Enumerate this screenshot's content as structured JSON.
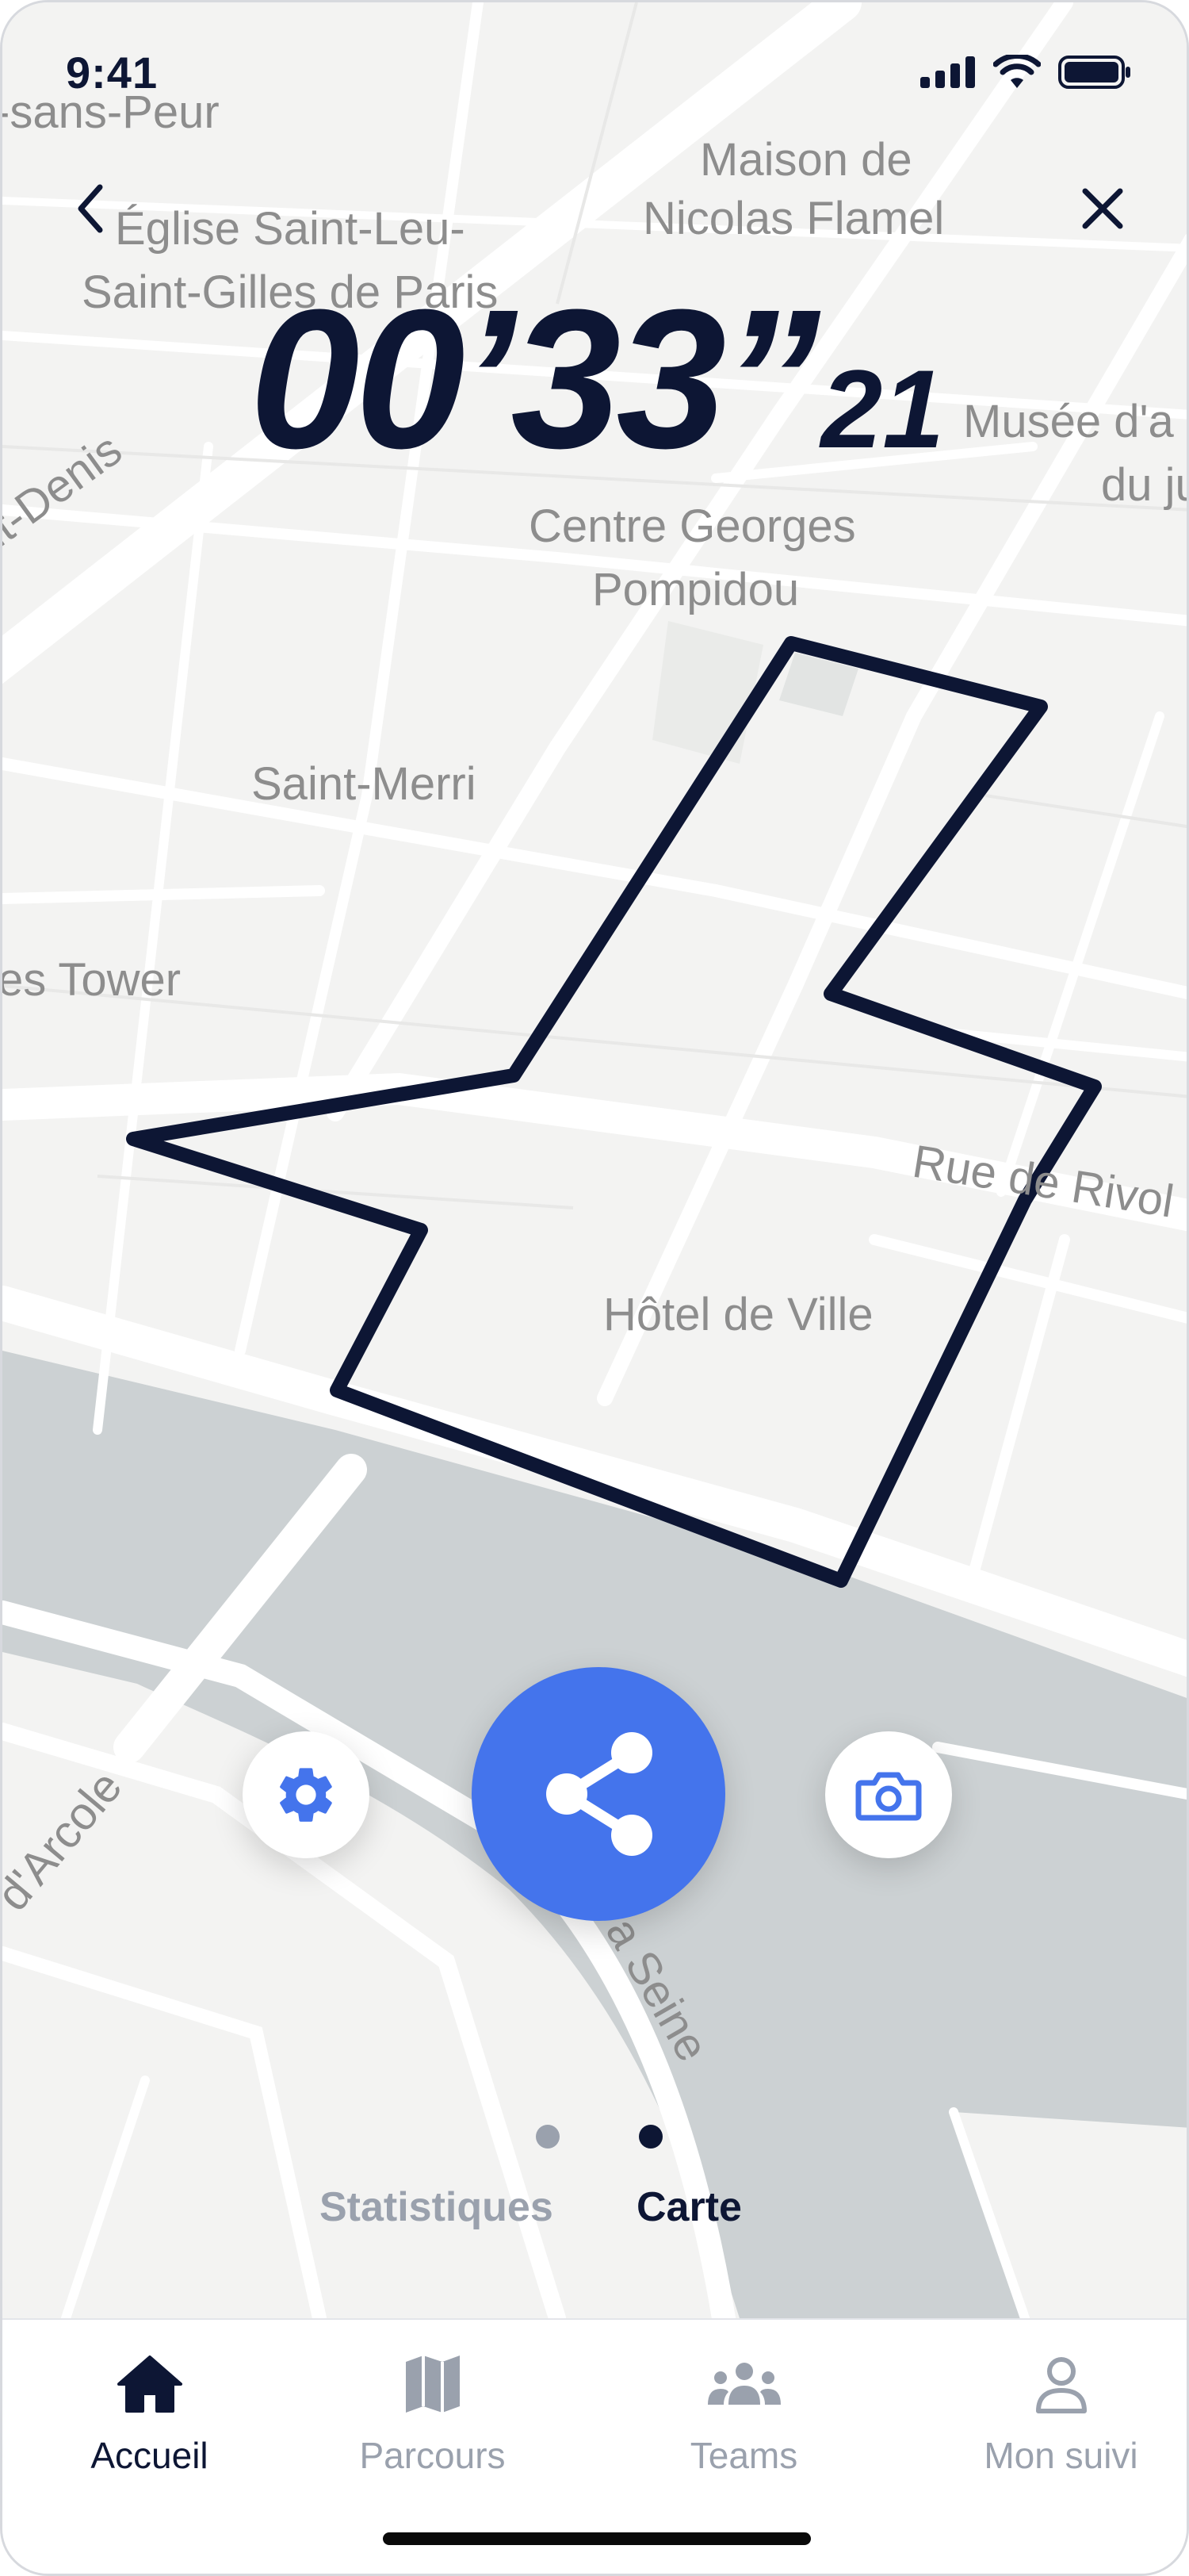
{
  "status_bar": {
    "time": "9:41"
  },
  "map": {
    "labels": {
      "sans_peur": "-sans-Peur",
      "maison_1": "Maison de",
      "maison_2": "Nicolas Flamel",
      "eglise_1": "Église Saint-Leu-",
      "eglise_2": "Saint-Gilles de Paris",
      "denis": "nt-Denis",
      "musee_1": "Musée d'a",
      "musee_2": "du ju",
      "centre_1": "Centre Georges",
      "centre_2": "Pompidou",
      "saint_merri": "Saint-Merri",
      "tower": "es Tower",
      "rivoli": "Rue de Rivol",
      "hotel_de_ville": "Hôtel de Ville",
      "arcole": "d'Arcole",
      "seine": "a Seine"
    }
  },
  "timer": {
    "main": "00’33”",
    "hundredths": "21"
  },
  "actions": {
    "settings_icon": "gear-icon",
    "share_icon": "share-icon",
    "camera_icon": "camera-icon"
  },
  "pager": {
    "items": [
      {
        "label": "Statistiques",
        "active": false
      },
      {
        "label": "Carte",
        "active": true
      }
    ]
  },
  "tabs": [
    {
      "label": "Accueil",
      "icon": "home-icon",
      "active": true
    },
    {
      "label": "Parcours",
      "icon": "map-icon",
      "active": false
    },
    {
      "label": "Teams",
      "icon": "team-icon",
      "active": false
    },
    {
      "label": "Mon suivi",
      "icon": "user-icon",
      "active": false
    }
  ],
  "colors": {
    "navy": "#0d1634",
    "accent": "#4474ec",
    "inactive": "#9aa1ad",
    "water": "#ccd1d3",
    "map_bg": "#f3f3f2"
  }
}
